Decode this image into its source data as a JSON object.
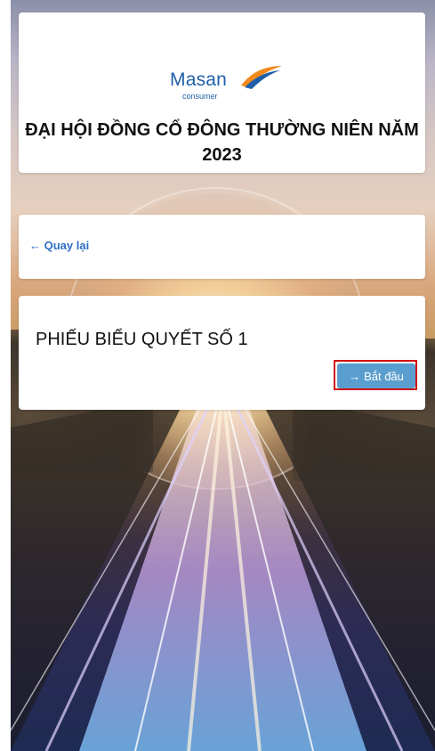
{
  "brand": {
    "name": "Masan",
    "tagline": "consumer",
    "color_primary": "#1f5fa8",
    "color_accent": "#f28a1c"
  },
  "meeting": {
    "title": "ĐẠI HỘI ĐỒNG CỔ ĐÔNG THƯỜNG NIÊN NĂM 2023"
  },
  "navigation": {
    "back_icon": "←",
    "back_label": "Quay lại"
  },
  "ballot": {
    "title": "PHIẾU BIỂU QUYẾT SỐ 1",
    "start_icon": "→",
    "start_label": "Bắt đầu",
    "start_button_color": "#5a9ecf"
  },
  "annotation": {
    "highlight_color": "#d10f0f"
  }
}
